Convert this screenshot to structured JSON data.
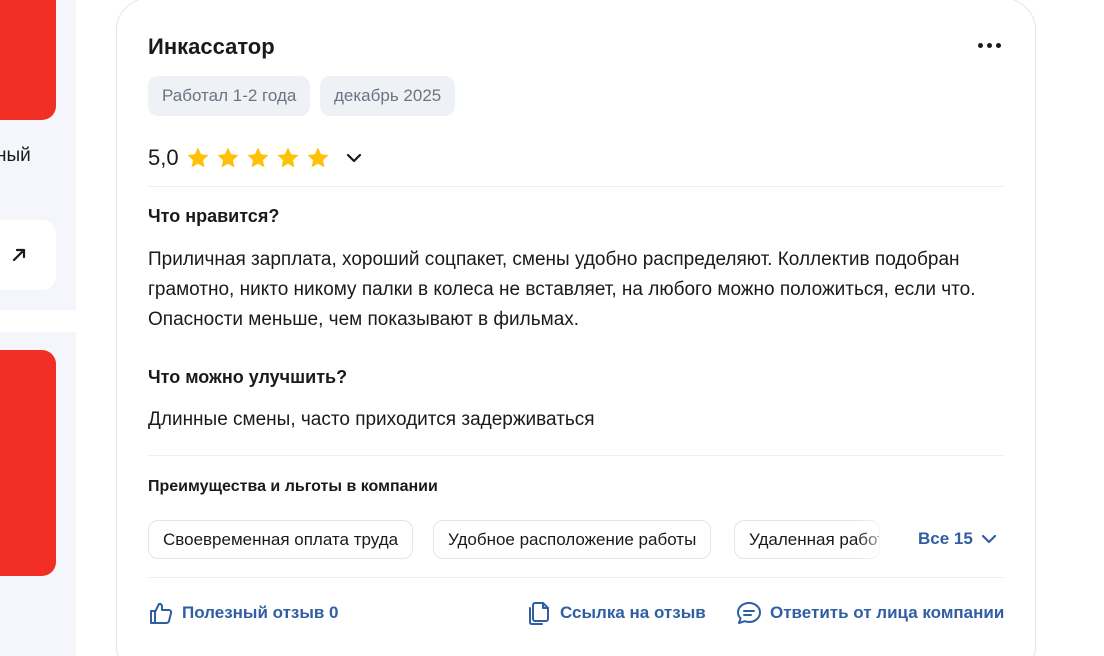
{
  "sidebar": {
    "partial_text": "ный"
  },
  "review": {
    "title": "Инкассатор",
    "tags": [
      "Работал 1-2 года",
      "декабрь 2025"
    ],
    "rating": "5,0",
    "stars": 5,
    "pros_heading": "Что нравится?",
    "pros_text": "Приличная зарплата, хороший соцпакет, смены удобно распределяют. Коллектив подобран грамотно, никто никому палки в колеса не вставляет, на любого можно положиться, если что. Опасности меньше, чем показывают в фильмах.",
    "cons_heading": "Что можно улучшить?",
    "cons_text": "Длинные смены, часто приходится задерживаться",
    "benefits_heading": "Преимущества и льготы в компании",
    "benefits": [
      "Своевременная оплата труда",
      "Удобное расположение работы",
      "Удаленная работа"
    ],
    "benefits_all": "Все 15",
    "actions": {
      "helpful": "Полезный отзыв 0",
      "link": "Ссылка на отзыв",
      "reply": "Ответить от лица компании"
    }
  },
  "colors": {
    "accent_red": "#f22f24",
    "link_blue": "#2f5ea3",
    "star_yellow": "#ffc107",
    "tag_bg": "#eef1f6"
  }
}
